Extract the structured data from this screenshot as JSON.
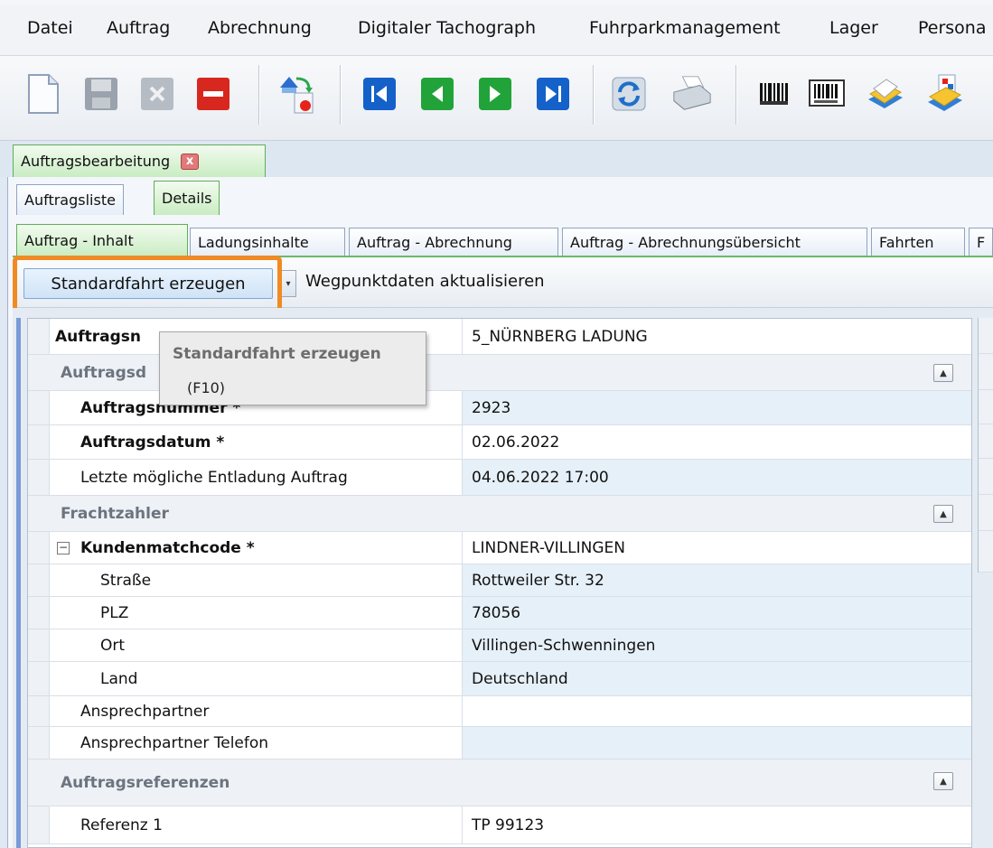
{
  "menu": {
    "items": [
      "Datei",
      "Auftrag",
      "Abrechnung",
      "Digitaler Tachograph",
      "Fuhrparkmanagement",
      "Lager",
      "Persona"
    ]
  },
  "toolbar": {
    "icons": [
      "new-document-icon",
      "save-icon",
      "delete-gray-icon",
      "remove-red-icon",
      "transfer-icon",
      "first-record-icon",
      "previous-record-icon",
      "next-record-icon",
      "last-record-icon",
      "refresh-icon",
      "print-icon",
      "barcode-icon",
      "barcode-label-icon",
      "document-stack-icon",
      "document-export-icon"
    ]
  },
  "tabs_level1": {
    "main": "Auftragsbearbeitung",
    "close": "x"
  },
  "tabs_level2": [
    "Auftragsliste",
    "Details"
  ],
  "tabs_level3": [
    "Auftrag - Inhalt",
    "Ladungsinhalte",
    "Auftrag - Abrechnung",
    "Auftrag - Abrechnungsübersicht",
    "Fahrten",
    "F"
  ],
  "actions": {
    "standard_trip": "Standardfahrt erzeugen",
    "dropdown_glyph": "▾",
    "update_waypoints": "Wegpunktdaten aktualisieren"
  },
  "tooltip": {
    "title": "Standardfahrt erzeugen",
    "shortcut": "(F10)"
  },
  "grid": {
    "top_row": {
      "label": "Auftragsn",
      "value": "5_NÜRNBERG LADUNG"
    },
    "category1": {
      "label": "Auftragsd"
    },
    "order_number": {
      "label": "Auftragsnummer *",
      "value": "2923"
    },
    "order_date": {
      "label": "Auftragsdatum *",
      "value": "02.06.2022"
    },
    "last_unload": {
      "label": "Letzte mögliche Entladung Auftrag",
      "value": "04.06.2022 17:00"
    },
    "category2": {
      "label": "Frachtzahler"
    },
    "customer": {
      "label": "Kundenmatchcode *",
      "value": "LINDNER-VILLINGEN"
    },
    "street": {
      "label": "Straße",
      "value": "Rottweiler Str. 32"
    },
    "zip": {
      "label": "PLZ",
      "value": "78056"
    },
    "city": {
      "label": "Ort",
      "value": "Villingen-Schwenningen"
    },
    "country": {
      "label": "Land",
      "value": "Deutschland"
    },
    "contact": {
      "label": "Ansprechpartner",
      "value": ""
    },
    "contact_phone": {
      "label": "Ansprechpartner Telefon",
      "value": ""
    },
    "category3": {
      "label": "Auftragsreferenzen"
    },
    "ref1": {
      "label": "Referenz 1",
      "value": "TP 99123"
    },
    "collapse_glyph": "▲",
    "expander_glyph": "−"
  },
  "colors": {
    "highlight": "#f08a24",
    "active_tab": "#c9ecc2",
    "value_alt": "#e6f0f8"
  }
}
